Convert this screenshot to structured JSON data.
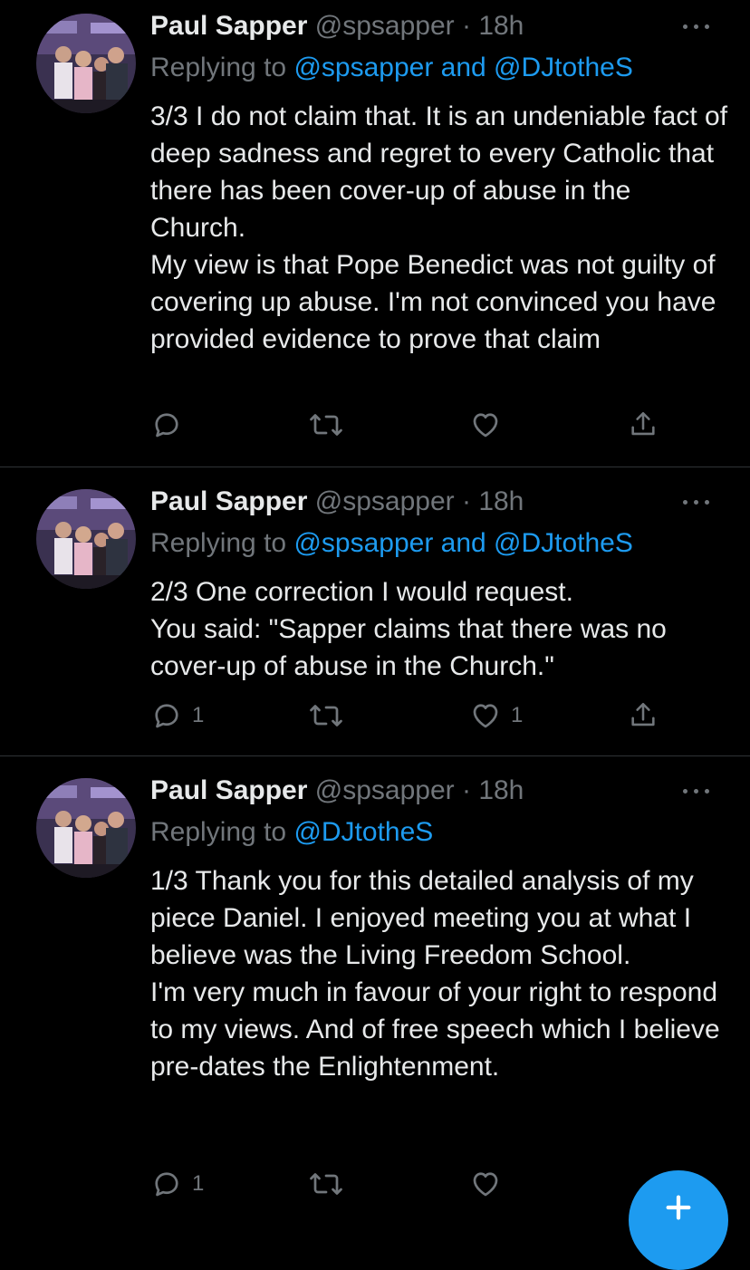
{
  "tweets": [
    {
      "name": "Paul Sapper",
      "handle": "@spsapper",
      "sep": "·",
      "time": "18h",
      "replying_prefix": "Replying to ",
      "replying_to": "@spsapper and @DJtotheS",
      "body": [
        "3/3 I do not claim that. It is an undeniable fact of deep sadness and regret to every Catholic that there has been cover-up of abuse in the Church.",
        "My view is that Pope Benedict was not guilty of covering up abuse. I'm not convinced you have provided evidence to prove that claim"
      ],
      "reply_count": "",
      "like_count": ""
    },
    {
      "name": "Paul Sapper",
      "handle": "@spsapper",
      "sep": "·",
      "time": "18h",
      "replying_prefix": "Replying to ",
      "replying_to": "@spsapper and @DJtotheS",
      "body": [
        "2/3 One correction I would request.",
        "You said: \"Sapper claims that there was no cover-up of abuse in the Church.\""
      ],
      "reply_count": "1",
      "like_count": "1"
    },
    {
      "name": "Paul Sapper",
      "handle": "@spsapper",
      "sep": "·",
      "time": "18h",
      "replying_prefix": "Replying to ",
      "replying_to": "@DJtotheS",
      "body": [
        "1/3 Thank you for this detailed analysis of my piece Daniel. I enjoyed meeting you at what I believe was the Living Freedom School.",
        "I'm very much in favour of your right to respond to my views. And of free speech which I believe pre-dates the Enlightenment."
      ],
      "reply_count": "1",
      "like_count": ""
    }
  ],
  "icons": {
    "reply": "reply-icon",
    "retweet": "retweet-icon",
    "like": "heart-icon",
    "share": "share-icon",
    "more": "more-icon",
    "compose": "compose-plus-icon"
  },
  "colors": {
    "background": "#000000",
    "text": "#e7e9ea",
    "muted": "#71767b",
    "link": "#1d9bf0",
    "divider": "#2f3336"
  }
}
